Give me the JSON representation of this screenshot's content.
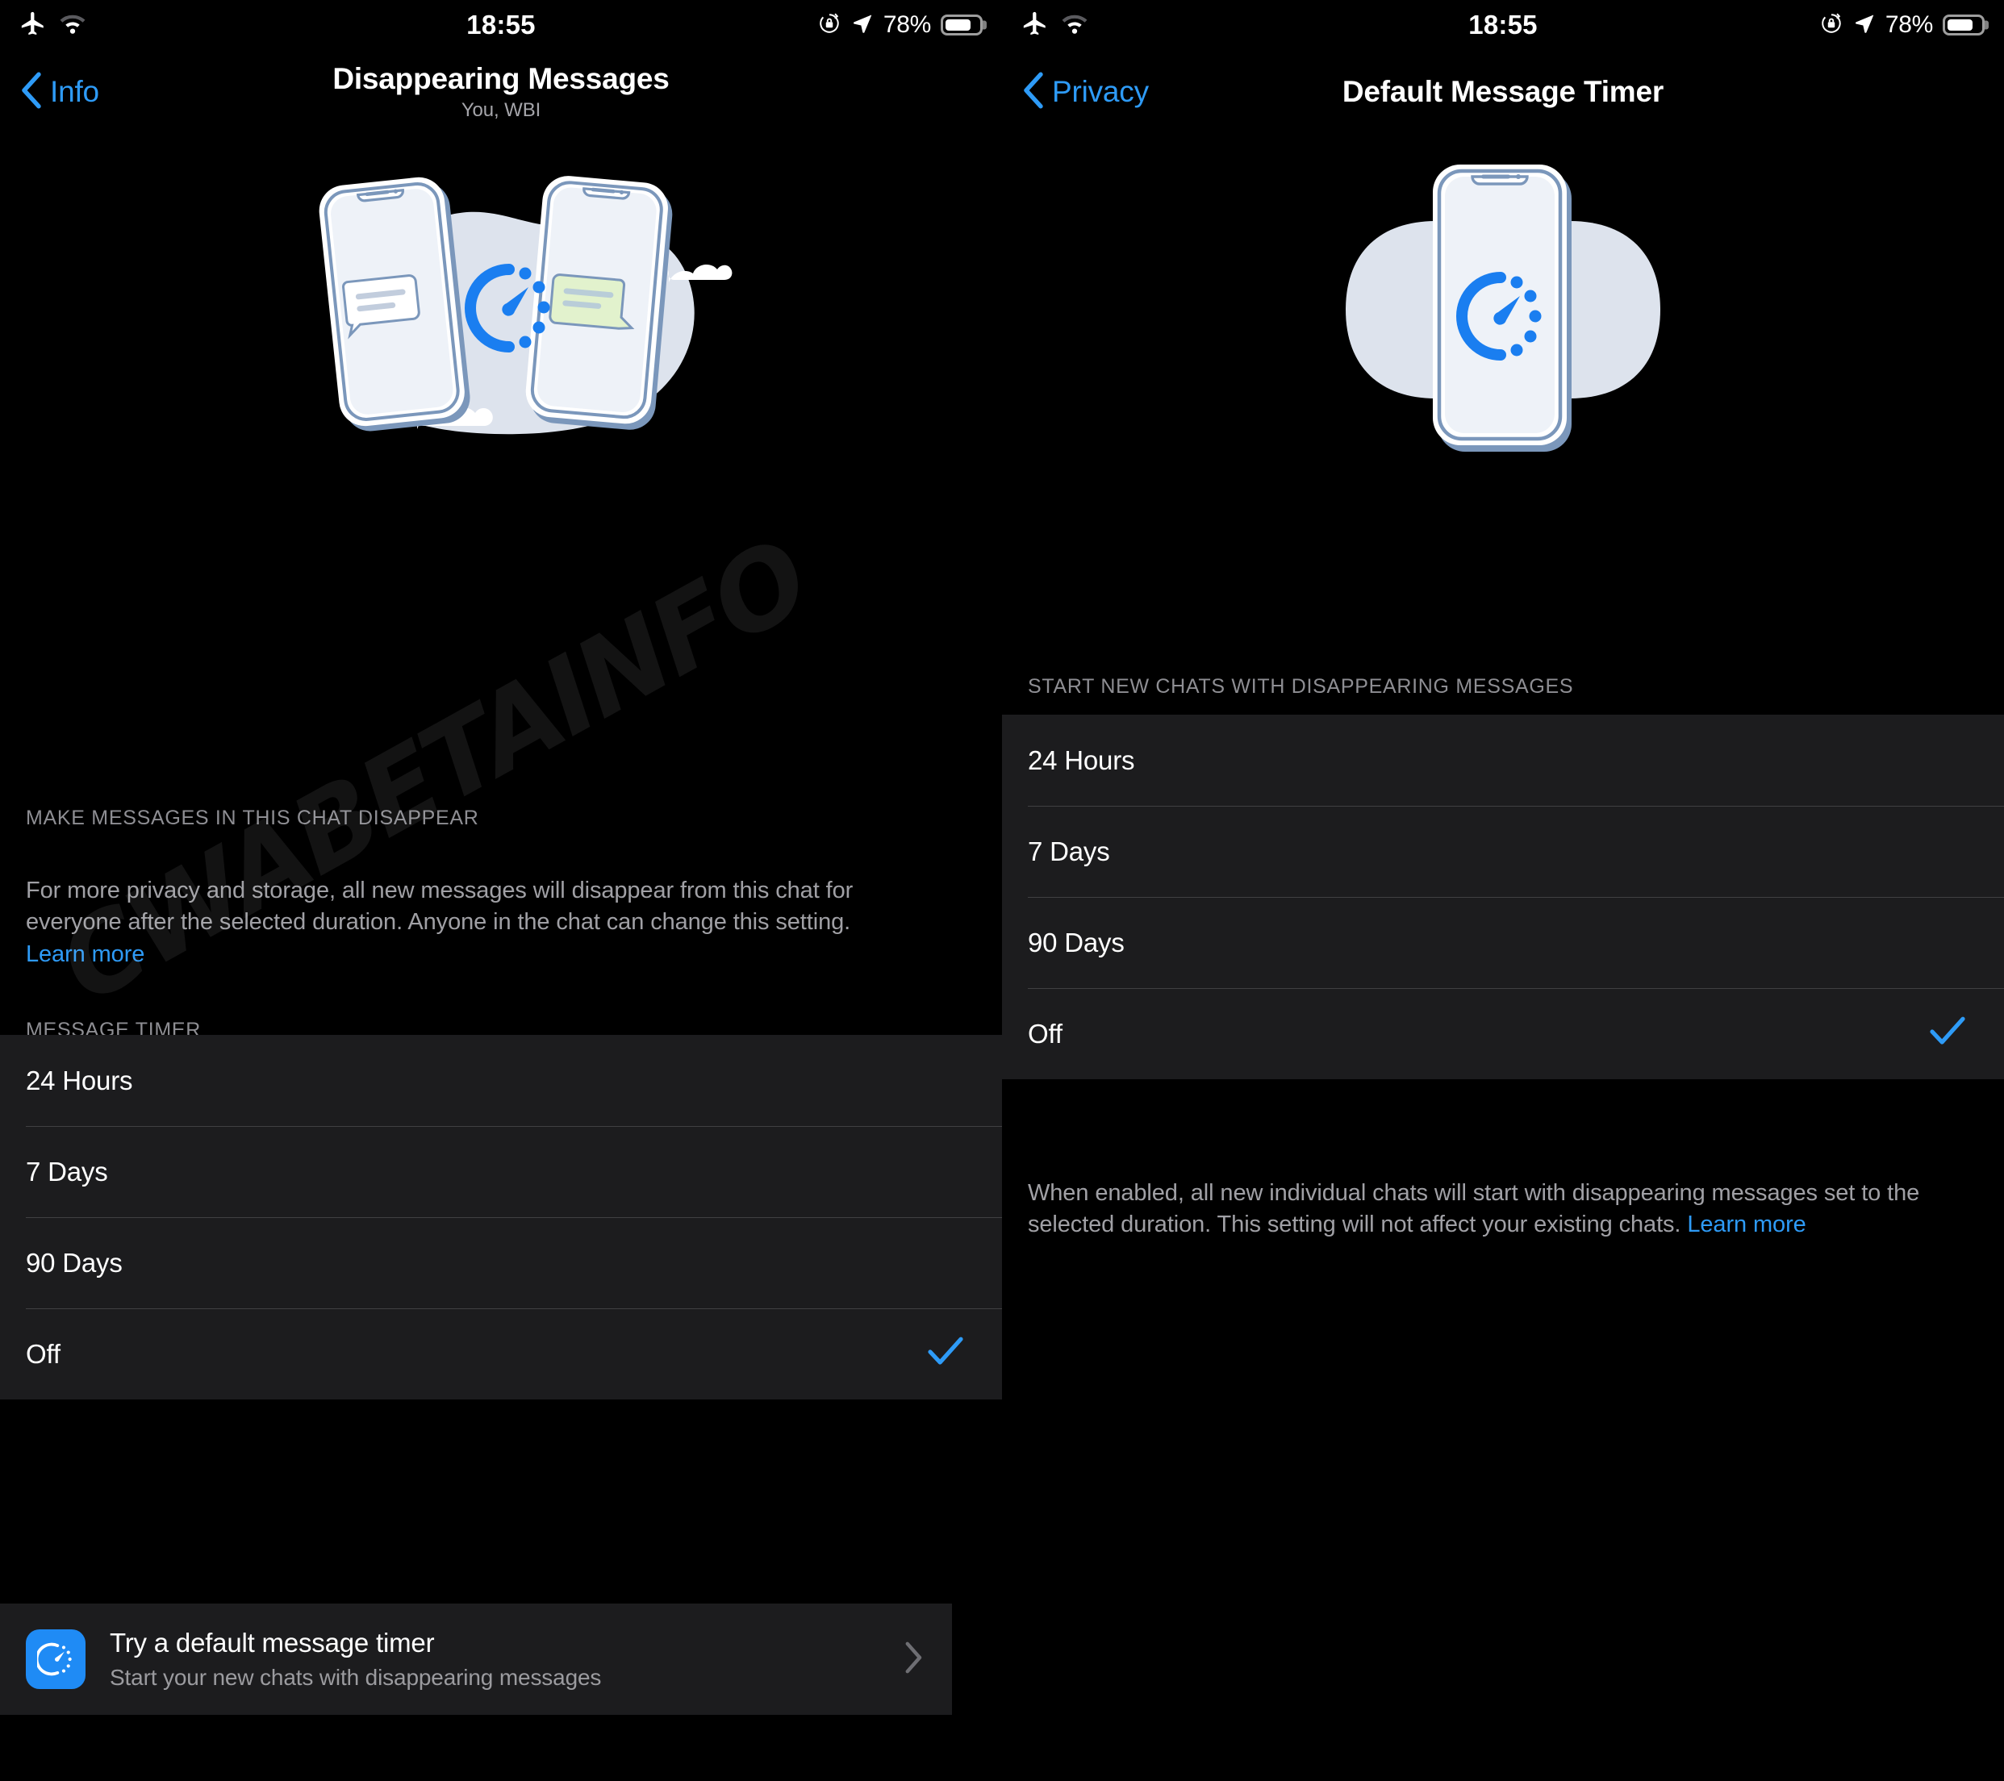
{
  "watermark": "CWABETAINFO",
  "accent_color": "#2e9bf7",
  "list_bg_color": "#1c1c1e",
  "panels": [
    {
      "id": "disappearing-messages",
      "status_bar": {
        "airplane_icon": "airplane-mode-icon",
        "wifi_icon": "wifi-icon",
        "time": "18:55",
        "rotation_lock_icon": "rotation-lock-icon",
        "location_icon": "location-arrow-icon",
        "battery_percent": "78%",
        "battery_icon": "battery-icon"
      },
      "nav": {
        "back_label": "Info",
        "back_icon": "chevron-left-icon",
        "title": "Disappearing Messages",
        "subtitle": "You, WBI"
      },
      "illustration": "two-phones-timer-illustration",
      "section_header": "MAKE MESSAGES IN THIS CHAT DISAPPEAR",
      "description": "For more privacy and storage, all new messages will disappear from this chat for everyone after the selected duration. Anyone in the chat can change this setting.",
      "learn_more": "Learn more",
      "list_header": "MESSAGE TIMER",
      "options": [
        {
          "label": "24 Hours",
          "selected": false
        },
        {
          "label": "7 Days",
          "selected": false
        },
        {
          "label": "90 Days",
          "selected": false
        },
        {
          "label": "Off",
          "selected": true
        }
      ],
      "promo": {
        "icon": "timer-icon",
        "title": "Try a default message timer",
        "subtitle": "Start your new chats with disappearing messages",
        "chevron_icon": "chevron-right-icon"
      }
    },
    {
      "id": "default-message-timer",
      "status_bar": {
        "airplane_icon": "airplane-mode-icon",
        "wifi_icon": "wifi-icon",
        "time": "18:55",
        "rotation_lock_icon": "rotation-lock-icon",
        "location_icon": "location-arrow-icon",
        "battery_percent": "78%",
        "battery_icon": "battery-icon"
      },
      "nav": {
        "back_label": "Privacy",
        "back_icon": "chevron-left-icon",
        "title": "Default Message Timer",
        "subtitle": ""
      },
      "illustration": "single-phone-timer-illustration",
      "list_header": "START NEW CHATS WITH DISAPPEARING MESSAGES",
      "options": [
        {
          "label": "24 Hours",
          "selected": false
        },
        {
          "label": "7 Days",
          "selected": false
        },
        {
          "label": "90 Days",
          "selected": false
        },
        {
          "label": "Off",
          "selected": true
        }
      ],
      "footer": "When enabled, all new individual chats will start with disappearing messages set to the selected duration. This setting will not affect your existing chats.",
      "learn_more": "Learn more",
      "checkmark": "✓"
    }
  ]
}
